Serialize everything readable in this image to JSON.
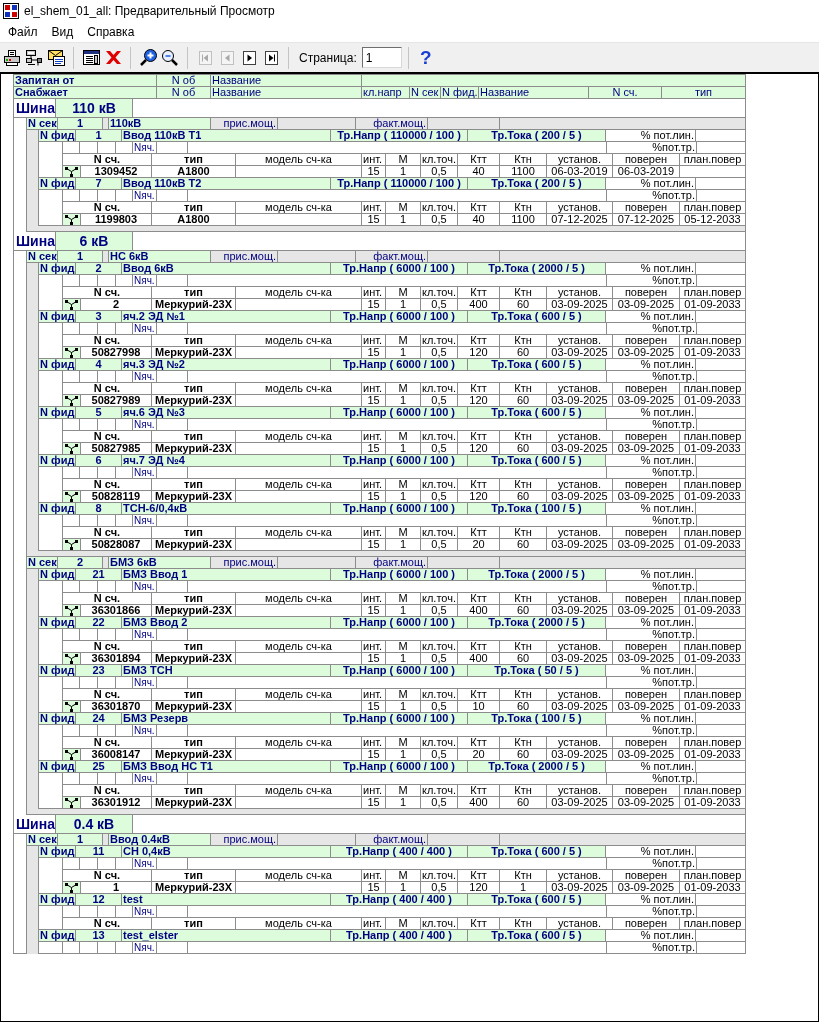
{
  "window": {
    "title": "el_shem_01_all: Предварительный Просмотр"
  },
  "menu": [
    "Файл",
    "Вид",
    "Справка"
  ],
  "toolbar": [
    {
      "kind": "buttons",
      "buttons": [
        {
          "kind": "printer",
          "disabled": false
        },
        {
          "kind": "printer_cable",
          "disabled": false
        },
        {
          "kind": "envelope",
          "disabled": false
        }
      ]
    },
    {
      "kind": "buttons",
      "buttons": [
        {
          "kind": "window",
          "disabled": false
        },
        {
          "kind": "close",
          "disabled": false
        }
      ]
    },
    {
      "kind": "buttons",
      "buttons": [
        {
          "kind": "zoom_in",
          "disabled": false
        },
        {
          "kind": "zoom_out",
          "disabled": false
        }
      ]
    },
    {
      "kind": "buttons",
      "buttons": [
        {
          "kind": "first",
          "disabled": true
        },
        {
          "kind": "previous",
          "disabled": true
        },
        {
          "kind": "next",
          "disabled": false
        },
        {
          "kind": "last",
          "disabled": false
        }
      ]
    },
    {
      "kind": "page_field",
      "label": "Страница:",
      "value": "1"
    },
    {
      "kind": "buttons",
      "buttons": [
        {
          "kind": "help",
          "glyph": "?",
          "disabled": false
        }
      ]
    }
  ],
  "report": {
    "header_rows": [
      [
        "Запитан от",
        "N об",
        "Название"
      ],
      [
        "Снабжает",
        "N об",
        "Название",
        "кл.напр",
        "N сек",
        "N фид.",
        "Название",
        "N сч.",
        "тип"
      ]
    ],
    "buses": [
      {
        "label": "Шина",
        "voltage": "110 кВ",
        "sections": [
          {
            "label": "N сек",
            "number": "1",
            "name": "110кВ",
            "connected_power": "прис.мощ.",
            "actual_power": "факт.мощ.",
            "feeders": [
              {
                "label": "N фид",
                "number": "1",
                "name": "Ввод 110кВ Т1",
                "voltage_ratio": "Тр.Напр ( 110000 / 100 )",
                "current_ratio": "Тр.Тока ( 200 / 5 )",
                "line_loss": "% пот.лин.",
                "transformer_loss": "%пот.тр.",
                "bay_label": "Nяч.",
                "meter_columns": [
                  "N сч.",
                  "тип",
                  "модель сч-ка",
                  "инт.",
                  "М",
                  "кл.точ.",
                  "Ктт",
                  "Ктн",
                  "установ.",
                  "поверен",
                  "план.повер"
                ],
                "meters": [
                  {
                    "number": "1309452",
                    "type": "A1800",
                    "interval": "15",
                    "multiplier": "1",
                    "accuracy": "0,5",
                    "ct": "40",
                    "vt": "1100",
                    "installed": "06-03-2019",
                    "verified": "06-03-2019"
                  }
                ]
              },
              {
                "label": "N фид",
                "number": "7",
                "name": "Ввод 110кВ Т2",
                "voltage_ratio": "Тр.Напр ( 110000 / 100 )",
                "current_ratio": "Тр.Тока ( 200 / 5 )",
                "line_loss": "% пот.лин.",
                "transformer_loss": "%пот.тр.",
                "bay_label": "Nяч.",
                "meter_columns": [
                  "N сч.",
                  "тип",
                  "модель сч-ка",
                  "инт.",
                  "М",
                  "кл.точ.",
                  "Ктт",
                  "Ктн",
                  "установ.",
                  "поверен",
                  "план.повер"
                ],
                "meters": [
                  {
                    "number": "1199803",
                    "type": "A1800",
                    "interval": "15",
                    "multiplier": "1",
                    "accuracy": "0,5",
                    "ct": "40",
                    "vt": "1100",
                    "installed": "07-12-2025",
                    "verified": "07-12-2025",
                    "next_verification": "05-12-2033"
                  }
                ]
              }
            ]
          }
        ]
      },
      {
        "label": "Шина",
        "voltage": "6 кВ",
        "sections": [
          {
            "label": "N сек",
            "number": "1",
            "name": "НС 6кВ",
            "connected_power": "прис.мощ.",
            "actual_power": "факт.мощ.",
            "feeders": [
              {
                "label": "N фид",
                "number": "2",
                "name": "Ввод 6кВ",
                "voltage_ratio": "Тр.Напр ( 6000 / 100 )",
                "current_ratio": "Тр.Тока ( 2000 / 5 )",
                "line_loss": "% пот.лин.",
                "transformer_loss": "%пот.тр.",
                "bay_label": "Nяч.",
                "meter_columns": [
                  "N сч.",
                  "тип",
                  "модель сч-ка",
                  "инт.",
                  "М",
                  "кл.точ.",
                  "Ктт",
                  "Ктн",
                  "установ.",
                  "поверен",
                  "план.повер"
                ],
                "meters": [
                  {
                    "number": "2",
                    "type": "Меркурий-23X",
                    "interval": "15",
                    "multiplier": "1",
                    "accuracy": "0,5",
                    "ct": "400",
                    "vt": "60",
                    "installed": "03-09-2025",
                    "verified": "03-09-2025",
                    "next_verification": "01-09-2033"
                  }
                ]
              },
              {
                "label": "N фид",
                "number": "3",
                "name": "яч.2 ЭД №1",
                "voltage_ratio": "Тр.Напр ( 6000 / 100 )",
                "current_ratio": "Тр.Тока ( 600 / 5 )",
                "line_loss": "% пот.лин.",
                "transformer_loss": "%пот.тр.",
                "bay_label": "Nяч.",
                "meter_columns": [
                  "N сч.",
                  "тип",
                  "модель сч-ка",
                  "инт.",
                  "М",
                  "кл.точ.",
                  "Ктт",
                  "Ктн",
                  "установ.",
                  "поверен",
                  "план.повер"
                ],
                "meters": [
                  {
                    "number": "50827998",
                    "type": "Меркурий-23X",
                    "interval": "15",
                    "multiplier": "1",
                    "accuracy": "0,5",
                    "ct": "120",
                    "vt": "60",
                    "installed": "03-09-2025",
                    "verified": "03-09-2025",
                    "next_verification": "01-09-2033"
                  }
                ]
              },
              {
                "label": "N фид",
                "number": "4",
                "name": "яч.3 ЭД №2",
                "voltage_ratio": "Тр.Напр ( 6000 / 100 )",
                "current_ratio": "Тр.Тока ( 600 / 5 )",
                "line_loss": "% пот.лин.",
                "transformer_loss": "%пот.тр.",
                "bay_label": "Nяч.",
                "meter_columns": [
                  "N сч.",
                  "тип",
                  "модель сч-ка",
                  "инт.",
                  "М",
                  "кл.точ.",
                  "Ктт",
                  "Ктн",
                  "установ.",
                  "поверен",
                  "план.повер"
                ],
                "meters": [
                  {
                    "number": "50827989",
                    "type": "Меркурий-23X",
                    "interval": "15",
                    "multiplier": "1",
                    "accuracy": "0,5",
                    "ct": "120",
                    "vt": "60",
                    "installed": "03-09-2025",
                    "verified": "03-09-2025",
                    "next_verification": "01-09-2033"
                  }
                ]
              },
              {
                "label": "N фид",
                "number": "5",
                "name": "яч.6 ЭД №3",
                "voltage_ratio": "Тр.Напр ( 6000 / 100 )",
                "current_ratio": "Тр.Тока ( 600 / 5 )",
                "line_loss": "% пот.лин.",
                "transformer_loss": "%пот.тр.",
                "bay_label": "Nяч.",
                "meter_columns": [
                  "N сч.",
                  "тип",
                  "модель сч-ка",
                  "инт.",
                  "М",
                  "кл.точ.",
                  "Ктт",
                  "Ктн",
                  "установ.",
                  "поверен",
                  "план.повер"
                ],
                "meters": [
                  {
                    "number": "50827985",
                    "type": "Меркурий-23X",
                    "interval": "15",
                    "multiplier": "1",
                    "accuracy": "0,5",
                    "ct": "120",
                    "vt": "60",
                    "installed": "03-09-2025",
                    "verified": "03-09-2025",
                    "next_verification": "01-09-2033"
                  }
                ]
              },
              {
                "label": "N фид",
                "number": "6",
                "name": "яч.7 ЭД №4",
                "voltage_ratio": "Тр.Напр ( 6000 / 100 )",
                "current_ratio": "Тр.Тока ( 600 / 5 )",
                "line_loss": "% пот.лин.",
                "transformer_loss": "%пот.тр.",
                "bay_label": "Nяч.",
                "meter_columns": [
                  "N сч.",
                  "тип",
                  "модель сч-ка",
                  "инт.",
                  "М",
                  "кл.точ.",
                  "Ктт",
                  "Ктн",
                  "установ.",
                  "поверен",
                  "план.повер"
                ],
                "meters": [
                  {
                    "number": "50828119",
                    "type": "Меркурий-23X",
                    "interval": "15",
                    "multiplier": "1",
                    "accuracy": "0,5",
                    "ct": "120",
                    "vt": "60",
                    "installed": "03-09-2025",
                    "verified": "03-09-2025",
                    "next_verification": "01-09-2033"
                  }
                ]
              },
              {
                "label": "N фид",
                "number": "8",
                "name": "ТСН-6/0,4кВ",
                "voltage_ratio": "Тр.Напр ( 6000 / 100 )",
                "current_ratio": "Тр.Тока ( 100 / 5 )",
                "line_loss": "% пот.лин.",
                "transformer_loss": "%пот.тр.",
                "bay_label": "Nяч.",
                "meter_columns": [
                  "N сч.",
                  "тип",
                  "модель сч-ка",
                  "инт.",
                  "М",
                  "кл.точ.",
                  "Ктт",
                  "Ктн",
                  "установ.",
                  "поверен",
                  "план.повер"
                ],
                "meters": [
                  {
                    "number": "50828087",
                    "type": "Меркурий-23X",
                    "interval": "15",
                    "multiplier": "1",
                    "accuracy": "0,5",
                    "ct": "20",
                    "vt": "60",
                    "installed": "03-09-2025",
                    "verified": "03-09-2025",
                    "next_verification": "01-09-2033"
                  }
                ]
              }
            ]
          },
          {
            "label": "N сек",
            "number": "2",
            "name": "БМЗ 6кВ",
            "connected_power": "прис.мощ.",
            "actual_power": "факт.мощ.",
            "feeders": [
              {
                "label": "N фид",
                "number": "21",
                "name": "БМЗ Ввод 1",
                "voltage_ratio": "Тр.Напр ( 6000 / 100 )",
                "current_ratio": "Тр.Тока ( 2000 / 5 )",
                "line_loss": "% пот.лин.",
                "transformer_loss": "%пот.тр.",
                "bay_label": "Nяч.",
                "meter_columns": [
                  "N сч.",
                  "тип",
                  "модель сч-ка",
                  "инт.",
                  "М",
                  "кл.точ.",
                  "Ктт",
                  "Ктн",
                  "установ.",
                  "поверен",
                  "план.повер"
                ],
                "meters": [
                  {
                    "number": "36301866",
                    "type": "Меркурий-23X",
                    "interval": "15",
                    "multiplier": "1",
                    "accuracy": "0,5",
                    "ct": "400",
                    "vt": "60",
                    "installed": "03-09-2025",
                    "verified": "03-09-2025",
                    "next_verification": "01-09-2033"
                  }
                ]
              },
              {
                "label": "N фид",
                "number": "22",
                "name": "БМЗ Ввод 2",
                "voltage_ratio": "Тр.Напр ( 6000 / 100 )",
                "current_ratio": "Тр.Тока ( 2000 / 5 )",
                "line_loss": "% пот.лин.",
                "transformer_loss": "%пот.тр.",
                "bay_label": "Nяч.",
                "meter_columns": [
                  "N сч.",
                  "тип",
                  "модель сч-ка",
                  "инт.",
                  "М",
                  "кл.точ.",
                  "Ктт",
                  "Ктн",
                  "установ.",
                  "поверен",
                  "план.повер"
                ],
                "meters": [
                  {
                    "number": "36301894",
                    "type": "Меркурий-23X",
                    "interval": "15",
                    "multiplier": "1",
                    "accuracy": "0,5",
                    "ct": "400",
                    "vt": "60",
                    "installed": "03-09-2025",
                    "verified": "03-09-2025",
                    "next_verification": "01-09-2033"
                  }
                ]
              },
              {
                "label": "N фид",
                "number": "23",
                "name": "БМЗ ТСН",
                "voltage_ratio": "Тр.Напр ( 6000 / 100 )",
                "current_ratio": "Тр.Тока ( 50 / 5 )",
                "line_loss": "% пот.лин.",
                "transformer_loss": "%пот.тр.",
                "bay_label": "Nяч.",
                "meter_columns": [
                  "N сч.",
                  "тип",
                  "модель сч-ка",
                  "инт.",
                  "М",
                  "кл.точ.",
                  "Ктт",
                  "Ктн",
                  "установ.",
                  "поверен",
                  "план.повер"
                ],
                "meters": [
                  {
                    "number": "36301870",
                    "type": "Меркурий-23X",
                    "interval": "15",
                    "multiplier": "1",
                    "accuracy": "0,5",
                    "ct": "10",
                    "vt": "60",
                    "installed": "03-09-2025",
                    "verified": "03-09-2025",
                    "next_verification": "01-09-2033"
                  }
                ]
              },
              {
                "label": "N фид",
                "number": "24",
                "name": "БМЗ Резерв",
                "voltage_ratio": "Тр.Напр ( 6000 / 100 )",
                "current_ratio": "Тр.Тока ( 100 / 5 )",
                "line_loss": "% пот.лин.",
                "transformer_loss": "%пот.тр.",
                "bay_label": "Nяч.",
                "meter_columns": [
                  "N сч.",
                  "тип",
                  "модель сч-ка",
                  "инт.",
                  "М",
                  "кл.точ.",
                  "Ктт",
                  "Ктн",
                  "установ.",
                  "поверен",
                  "план.повер"
                ],
                "meters": [
                  {
                    "number": "36008147",
                    "type": "Меркурий-23X",
                    "interval": "15",
                    "multiplier": "1",
                    "accuracy": "0,5",
                    "ct": "20",
                    "vt": "60",
                    "installed": "03-09-2025",
                    "verified": "03-09-2025",
                    "next_verification": "01-09-2033"
                  }
                ]
              },
              {
                "label": "N фид",
                "number": "25",
                "name": "БМЗ Ввод НС Т1",
                "voltage_ratio": "Тр.Напр ( 6000 / 100 )",
                "current_ratio": "Тр.Тока ( 2000 / 5 )",
                "line_loss": "% пот.лин.",
                "transformer_loss": "%пот.тр.",
                "bay_label": "Nяч.",
                "meter_columns": [
                  "N сч.",
                  "тип",
                  "модель сч-ка",
                  "инт.",
                  "М",
                  "кл.точ.",
                  "Ктт",
                  "Ктн",
                  "установ.",
                  "поверен",
                  "план.повер"
                ],
                "meters": [
                  {
                    "number": "36301912",
                    "type": "Меркурий-23X",
                    "interval": "15",
                    "multiplier": "1",
                    "accuracy": "0,5",
                    "ct": "400",
                    "vt": "60",
                    "installed": "03-09-2025",
                    "verified": "03-09-2025",
                    "next_verification": "01-09-2033"
                  }
                ]
              }
            ]
          }
        ]
      },
      {
        "label": "Шина",
        "voltage": "0.4 кВ",
        "sections": [
          {
            "label": "N сек",
            "number": "1",
            "name": "Ввод 0.4кВ",
            "connected_power": "прис.мощ.",
            "actual_power": "факт.мощ.",
            "feeders": [
              {
                "label": "N фид",
                "number": "11",
                "name": "СН 0,4кВ",
                "voltage_ratio": "Тр.Напр ( 400 / 400 )",
                "current_ratio": "Тр.Тока ( 600 / 5 )",
                "line_loss": "% пот.лин.",
                "transformer_loss": "%пот.тр.",
                "bay_label": "Nяч.",
                "meter_columns": [
                  "N сч.",
                  "тип",
                  "модель сч-ка",
                  "инт.",
                  "М",
                  "кл.точ.",
                  "Ктт",
                  "Ктн",
                  "установ.",
                  "поверен",
                  "план.повер"
                ],
                "meters": [
                  {
                    "number": "1",
                    "type": "Меркурий-23X",
                    "interval": "15",
                    "multiplier": "1",
                    "accuracy": "0,5",
                    "ct": "120",
                    "vt": "1",
                    "installed": "03-09-2025",
                    "verified": "03-09-2025",
                    "next_verification": "01-09-2033"
                  }
                ]
              },
              {
                "label": "N фид",
                "number": "12",
                "name": "test",
                "voltage_ratio": "Тр.Напр ( 400 / 400 )",
                "current_ratio": "Тр.Тока ( 600 / 5 )",
                "line_loss": "% пот.лин.",
                "transformer_loss": "%пот.тр.",
                "bay_label": "Nяч.",
                "meter_columns": [
                  "N сч.",
                  "тип",
                  "модель сч-ка",
                  "инт.",
                  "М",
                  "кл.точ.",
                  "Ктт",
                  "Ктн",
                  "установ.",
                  "поверен",
                  "план.повер"
                ]
              },
              {
                "label": "N фид",
                "number": "13",
                "name": "test_elster",
                "voltage_ratio": "Тр.Напр ( 400 / 400 )",
                "current_ratio": "Тр.Тока ( 600 / 5 )",
                "line_loss": "% пот.лин.",
                "transformer_loss": "%пот.тр.",
                "bay_label": "Nяч."
              }
            ]
          }
        ]
      }
    ]
  }
}
